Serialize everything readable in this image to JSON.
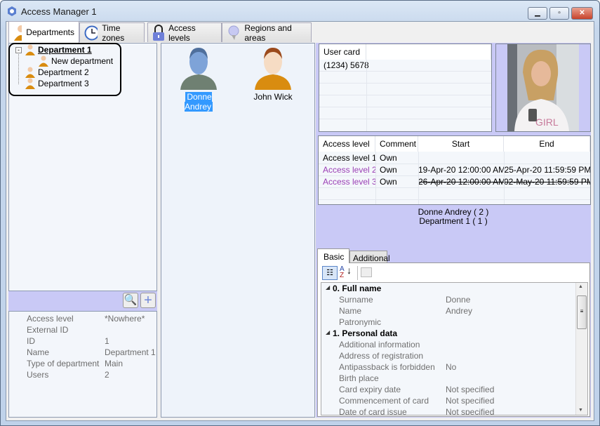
{
  "window": {
    "title": "Access Manager 1",
    "controls": [
      "minimize",
      "maximize",
      "close"
    ]
  },
  "tabs": [
    {
      "label": "Departments",
      "icon": "person-icon",
      "active": true
    },
    {
      "label": "Time zones",
      "icon": "clock-icon"
    },
    {
      "label": "Access levels",
      "icon": "lock-icon"
    },
    {
      "label": "Regions and areas",
      "icon": "pin-icon"
    }
  ],
  "tree": [
    {
      "label": "Department  1",
      "selected": true,
      "children": [
        {
          "label": "New department"
        }
      ]
    },
    {
      "label": "Department 2"
    },
    {
      "label": "Department 3"
    }
  ],
  "department_props": [
    {
      "name": "Access level",
      "value": "*Nowhere*"
    },
    {
      "name": "External ID",
      "value": ""
    },
    {
      "name": "ID",
      "value": "1"
    },
    {
      "name": "Name",
      "value": "Department 1"
    },
    {
      "name": "Type of department",
      "value": "Main"
    },
    {
      "name": "Users",
      "value": "2"
    }
  ],
  "users": [
    {
      "name": "Donne Andrey",
      "selected": true
    },
    {
      "name": "John Wick"
    }
  ],
  "user_card": {
    "header": "User card",
    "rows": [
      "(1234) 5678"
    ]
  },
  "access_table": {
    "columns": [
      "Access level",
      "Comment",
      "Start",
      "End"
    ],
    "rows": [
      {
        "level": "Access level 1",
        "comment": "Own",
        "start": "",
        "end": ""
      },
      {
        "level": "Access level 2",
        "comment": "Own",
        "start": "19-Apr-20 12:00:00 AM",
        "end": "25-Apr-20 11:59:59 PM"
      },
      {
        "level": "Access level 3",
        "comment": "Own",
        "start": "26-Apr-20 12:00:00 AM",
        "end": "02-May-20 11:59:59 PM"
      }
    ]
  },
  "summary": {
    "line1": "Donne Andrey ( 2 )",
    "line2": "Department 1 ( 1 )"
  },
  "prop_tabs": {
    "basic": "Basic",
    "additional": "Additional"
  },
  "property_grid": {
    "cat0": "0. Full name",
    "full_name": [
      {
        "name": "Surname",
        "value": "Donne"
      },
      {
        "name": "Name",
        "value": "Andrey"
      },
      {
        "name": "Patronymic",
        "value": ""
      }
    ],
    "cat1": "1. Personal data",
    "personal": [
      {
        "name": "Additional information",
        "value": ""
      },
      {
        "name": "Address of registration",
        "value": ""
      },
      {
        "name": "Antipassback is forbidden",
        "value": "No"
      },
      {
        "name": "Birth place",
        "value": ""
      },
      {
        "name": "Card expiry date",
        "value": "Not specified"
      },
      {
        "name": "Commencement of card",
        "value": "Not specified"
      },
      {
        "name": "Date of card issue",
        "value": "Not specified"
      }
    ]
  },
  "colors": {
    "lavender": "#c9c9f6",
    "purple_text": "#9b3fb5",
    "selection": "#3399ff"
  }
}
